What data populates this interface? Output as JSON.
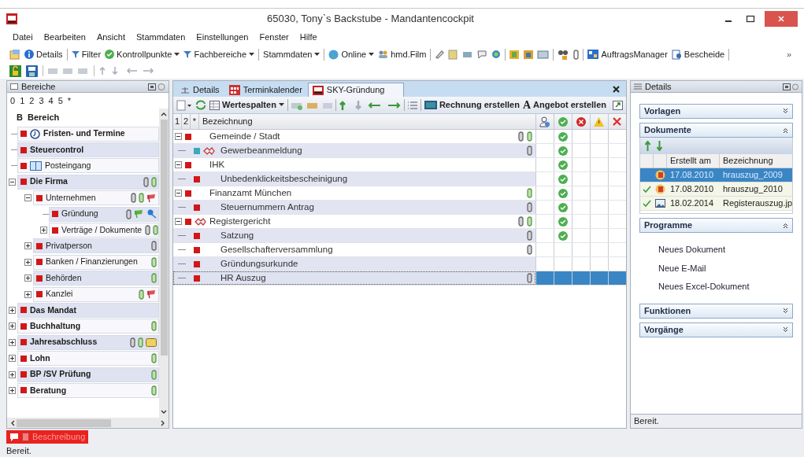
{
  "window": {
    "title": "65030, Tony`s Backstube - Mandantencockpit"
  },
  "menu": [
    "Datei",
    "Bearbeiten",
    "Ansicht",
    "Stammdaten",
    "Einstellungen",
    "Fenster",
    "Hilfe"
  ],
  "toolbar": [
    {
      "label": "Details",
      "dropdown": false
    },
    {
      "label": "Filter",
      "dropdown": false
    },
    {
      "label": "Kontrollpunkte",
      "dropdown": true
    },
    {
      "label": "Fachbereiche",
      "dropdown": true
    },
    {
      "label": "Stammdaten",
      "dropdown": true
    },
    {
      "label": "Online",
      "dropdown": true
    },
    {
      "label": "hmd.Film",
      "dropdown": false
    },
    {
      "label": "AuftragsManager",
      "dropdown": false
    },
    {
      "label": "Bescheide",
      "dropdown": false
    }
  ],
  "toolbar_overflow": "»",
  "areas": {
    "title": "Bereiche",
    "levels": [
      "0",
      "1",
      "2",
      "3",
      "4",
      "5",
      "*"
    ],
    "columns": [
      "B",
      "Bereich"
    ],
    "items": [
      {
        "label": "Fristen- und Termine",
        "bold": true
      },
      {
        "label": "Steuercontrol",
        "bold": true
      },
      {
        "label": "Posteingang",
        "bold": false
      },
      {
        "label": "Die Firma",
        "bold": true,
        "expanded": true,
        "children": [
          {
            "label": "Unternehmen",
            "bold": false,
            "expanded": true,
            "children": [
              {
                "label": "Gründung",
                "bold": false
              },
              {
                "label": "Verträge / Dokumente",
                "bold": false,
                "expanded": false
              }
            ]
          },
          {
            "label": "Privatperson",
            "bold": false,
            "expanded": false
          },
          {
            "label": "Banken / Finanzierungen",
            "bold": false,
            "expanded": false
          },
          {
            "label": "Behörden",
            "bold": false,
            "expanded": false
          },
          {
            "label": "Kanzlei",
            "bold": false,
            "expanded": false
          }
        ]
      },
      {
        "label": "Das Mandat",
        "bold": true,
        "expanded": false
      },
      {
        "label": "Buchhaltung",
        "bold": true,
        "expanded": false
      },
      {
        "label": "Jahresabschluss",
        "bold": true,
        "expanded": false
      },
      {
        "label": "Lohn",
        "bold": true,
        "expanded": false
      },
      {
        "label": "BP /SV Prüfung",
        "bold": true,
        "expanded": false
      },
      {
        "label": "Beratung",
        "bold": true,
        "expanded": false
      }
    ]
  },
  "document": {
    "tabs": [
      {
        "label": "Details",
        "kind": "details",
        "selected": false
      },
      {
        "label": "Terminkalender",
        "kind": "calendar",
        "selected": false
      },
      {
        "label": "SKY-Gründung",
        "kind": "case",
        "selected": true
      }
    ],
    "toolbar": [
      {
        "label": "Wertespalten",
        "dropdown": true
      },
      {
        "label": "Rechnung erstellen",
        "dropdown": false
      },
      {
        "label": "Angebot erstellen",
        "glyph": "A",
        "dropdown": false
      }
    ],
    "columns": [
      "1",
      "2",
      "*",
      "Bezeichnung"
    ],
    "rows": [
      {
        "label": "Gemeinde / Stadt",
        "color": "#d01818",
        "expanded": true,
        "done": true,
        "selected": false,
        "children": [
          {
            "label": "Gewerbeanmeldung",
            "color": "#3aaab8",
            "done": true,
            "selected": false
          }
        ]
      },
      {
        "label": "IHK",
        "color": "#d01818",
        "expanded": true,
        "done": true,
        "selected": false,
        "children": [
          {
            "label": "Unbedenklickeitsbescheinigung",
            "color": "#d01818",
            "done": true,
            "selected": false
          }
        ]
      },
      {
        "label": "Finanzamt München",
        "color": "#d01818",
        "expanded": true,
        "done": true,
        "selected": false,
        "children": [
          {
            "label": "Steuernummern Antrag",
            "color": "#d01818",
            "done": true,
            "selected": false
          }
        ]
      },
      {
        "label": "Registergericht",
        "color": "#d01818",
        "expanded": true,
        "done": true,
        "selected": false,
        "children": [
          {
            "label": "Satzung",
            "color": "#d01818",
            "done": true,
            "selected": false
          },
          {
            "label": "Gesellschafterversammlung",
            "color": "#d01818",
            "done": false,
            "selected": false
          },
          {
            "label": "Gründungsurkunde",
            "color": "#d01818",
            "done": false,
            "selected": false
          },
          {
            "label": "HR Auszug",
            "color": "#d01818",
            "done": false,
            "selected": true
          }
        ]
      }
    ]
  },
  "details": {
    "title": "Details",
    "sections": [
      {
        "title": "Vorlagen",
        "expanded": false
      },
      {
        "title": "Dokumente",
        "expanded": true,
        "columns": [
          "Erstellt am",
          "Bezeichnung"
        ],
        "rows": [
          {
            "date": "17.08.2010",
            "name": "hrauszug_2009",
            "checked": false,
            "selected": true
          },
          {
            "date": "17.08.2010",
            "name": "hrauszug_2010",
            "checked": true,
            "selected": false
          },
          {
            "date": "18.02.2014",
            "name": "Registerauszug.jp",
            "checked": true,
            "selected": false
          }
        ]
      },
      {
        "title": "Programme",
        "expanded": true,
        "items": [
          "Neues Dokument",
          "Neue E-Mail",
          "Neues Excel-Dokument"
        ]
      },
      {
        "title": "Funktionen",
        "expanded": false
      },
      {
        "title": "Vorgänge",
        "expanded": false
      }
    ],
    "status": "Bereit."
  },
  "description_button": "Beschreibung",
  "status_bar": "Bereit."
}
